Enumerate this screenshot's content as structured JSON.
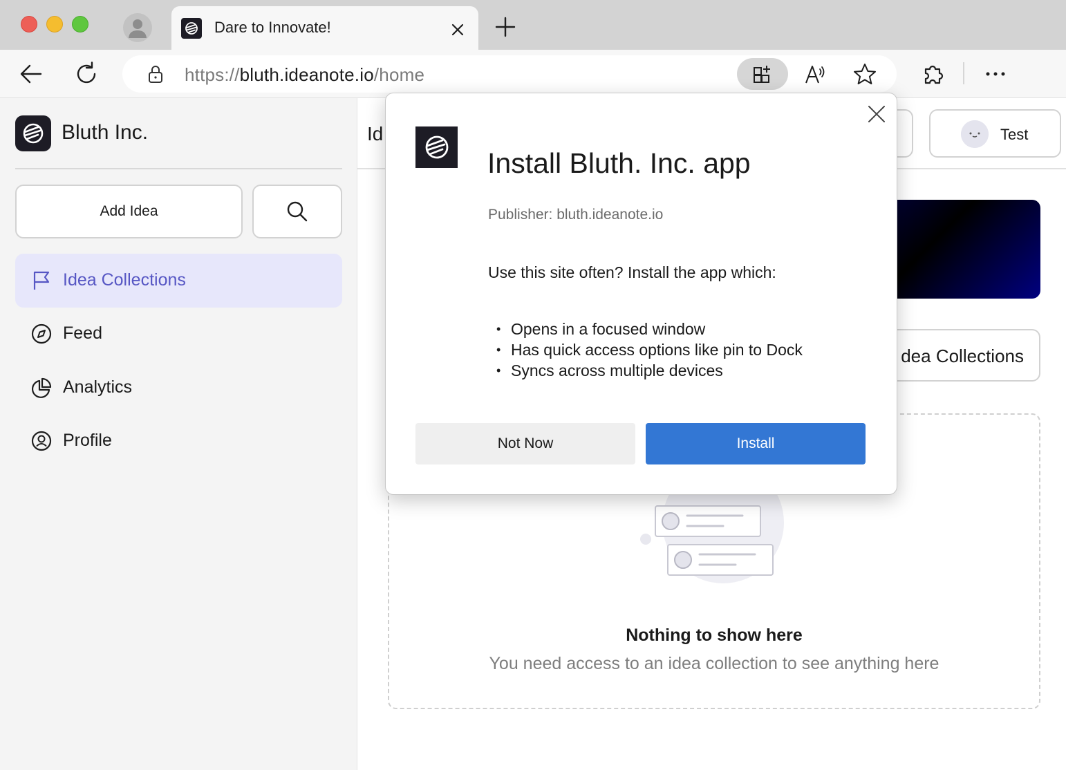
{
  "browser": {
    "tab_title": "Dare to Innovate!",
    "url_scheme": "https://",
    "url_host": "bluth.ideanote.io",
    "url_path": "/home",
    "icons": {
      "back": "back-arrow-icon",
      "reload": "reload-icon",
      "lock": "site-info-lock-icon",
      "app_available": "app-available-icon",
      "read_aloud": "read-aloud-icon",
      "favorite": "star-icon",
      "extensions": "puzzle-icon",
      "menu": "more-dots-icon"
    }
  },
  "sidebar": {
    "brand": "Bluth Inc.",
    "add_idea_label": "Add Idea",
    "nav": [
      {
        "label": "Idea Collections",
        "icon": "flag-icon",
        "active": true
      },
      {
        "label": "Feed",
        "icon": "compass-icon",
        "active": false
      },
      {
        "label": "Analytics",
        "icon": "pie-chart-icon",
        "active": false
      },
      {
        "label": "Profile",
        "icon": "profile-icon",
        "active": false
      }
    ]
  },
  "main": {
    "heading_partial": "Id",
    "user_name": "Test",
    "collections_button_partial": "dea Collections",
    "empty_title": "Nothing to show here",
    "empty_subtitle": "You need access to an idea collection to see anything here"
  },
  "dialog": {
    "title": "Install Bluth. Inc. app",
    "publisher": "Publisher: bluth.ideanote.io",
    "intro": "Use this site often? Install the app which:",
    "benefits": [
      "Opens in a focused window",
      "Has quick access options like pin to Dock",
      "Syncs across multiple devices"
    ],
    "not_now_label": "Not Now",
    "install_label": "Install"
  },
  "colors": {
    "accent_active": "#5757c4",
    "active_nav_bg": "#e7e7fb",
    "install_button": "#3377d4",
    "logo_bg": "#1d1c25"
  }
}
